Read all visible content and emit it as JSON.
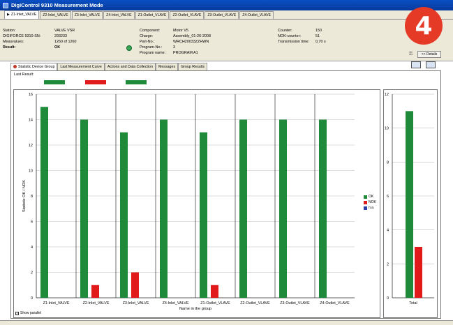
{
  "window": {
    "title": "DigiControl 9310 Measurement Mode"
  },
  "tabs": [
    "Z1-Inlet_VALVE",
    "Z2-Inlet_VALVE",
    "Z3-Inlet_VALVE",
    "Z4-Inlet_VALVE",
    "Z1-Outlet_VLAVE",
    "Z2-Outlet_VLAVE",
    "Z3-Outlet_VLAVE",
    "Z4-Outlet_VLAVE"
  ],
  "info": {
    "station_label": "Station:",
    "station_value": "VALVE VSR",
    "sn_label": "DIGIFORCE 9310-SN:",
    "sn_value": "293233",
    "meas_label": "Measvalues:",
    "meas_value": "1260 of 1260",
    "result_label": "Result:",
    "result_value": "OK",
    "component_label": "Component:",
    "component_value": "Motor V5",
    "charge_label": "Charge:",
    "charge_value": "Assembly_01-26-2008",
    "part_label": "Part-No.:",
    "part_value": "WRCH20033ZZHWN",
    "program_label": "Program-No.:",
    "program_value": "3",
    "progname_label": "Program name:",
    "progname_value": "PROGRAM A1",
    "counter_label": "Counter:",
    "counter_value": "150",
    "nok_label": "NOK-counter:",
    "nok_value": "51",
    "trans_label": "Transmission time:",
    "trans_value": "0,70 s"
  },
  "badge": "4",
  "details_button": "<< Details",
  "subtabs": [
    "Statistic Device Group",
    "Last Measurement Curve",
    "Actions and Data Collection",
    "Messages",
    "Group Results"
  ],
  "last_result_label": "Last Result:",
  "last_result_colors": [
    "#1f8a3a",
    "#e11b1b",
    "#1f8a3a"
  ],
  "show_parallel": "Show parallel",
  "colors": {
    "ok": "#1f8a3a",
    "nok": "#e11b1b",
    "na": "#2a3fa8"
  },
  "chart_data": [
    {
      "type": "bar",
      "categories": [
        "Z1-Inlet_VALVE",
        "Z2-Inlet_VALVE",
        "Z3-Inlet_VALVE",
        "Z4-Inlet_VALVE",
        "Z1-Outlet_VLAVE",
        "Z2-Outlet_VLAVE",
        "Z3-Outlet_VLAVE",
        "Z4-Outlet_VLAVE"
      ],
      "series": [
        {
          "name": "OK",
          "values": [
            15,
            14,
            13,
            14,
            13,
            14,
            14,
            14
          ]
        },
        {
          "name": "NOK",
          "values": [
            0,
            1,
            2,
            0,
            1,
            0,
            0,
            0
          ]
        }
      ],
      "xlabel": "Name in the group",
      "ylabel": "Statistic OK / NOK",
      "ylim": [
        0,
        16
      ],
      "yticks": [
        "0",
        "2",
        "4",
        "6",
        "8",
        "10",
        "12",
        "14",
        "16"
      ],
      "legend": [
        "OK",
        "NOK",
        "n.a."
      ]
    },
    {
      "type": "bar",
      "categories": [
        "Total"
      ],
      "series": [
        {
          "name": "OK",
          "values": [
            11
          ]
        },
        {
          "name": "NOK",
          "values": [
            3
          ]
        }
      ],
      "ylim": [
        0,
        12
      ],
      "yticks": [
        "0",
        "2",
        "4",
        "6",
        "8",
        "10",
        "12"
      ]
    }
  ]
}
